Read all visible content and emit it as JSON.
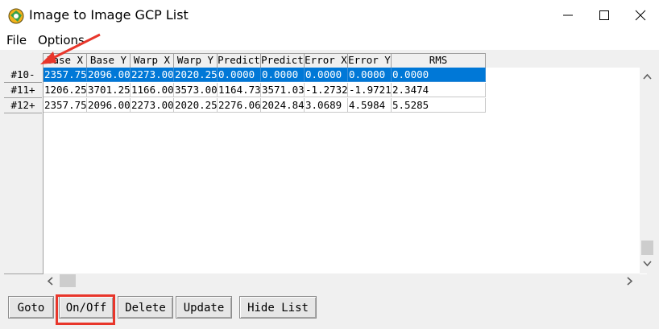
{
  "window": {
    "title": "Image to Image GCP List",
    "minimize_icon": "minimize-icon",
    "maximize_icon": "maximize-icon",
    "close_icon": "close-icon"
  },
  "menu": {
    "file": "File",
    "options": "Options"
  },
  "grid": {
    "columns": [
      "Base X",
      "Base Y",
      "Warp X",
      "Warp Y",
      "Predict",
      "Predict",
      "Error X",
      "Error Y",
      "RMS"
    ],
    "rows": [
      {
        "header": "#10-",
        "selected": true,
        "cells": [
          "2357.75",
          "2096.00",
          "2273.00",
          "2020.25",
          "0.0000",
          "0.0000",
          "0.0000",
          "0.0000",
          "0.0000"
        ]
      },
      {
        "header": "#11+",
        "selected": false,
        "cells": [
          "1206.25",
          "3701.25",
          "1166.00",
          "3573.00",
          "1164.73",
          "3571.03",
          "-1.2732",
          "-1.9721",
          "2.3474"
        ]
      },
      {
        "header": "#12+",
        "selected": false,
        "cells": [
          "2357.75",
          "2096.00",
          "2273.00",
          "2020.25",
          "2276.06",
          "2024.84",
          "3.0689",
          "4.5984",
          "5.5285"
        ]
      }
    ]
  },
  "buttons": {
    "goto": "Goto",
    "on_off": "On/Off",
    "delete": "Delete",
    "update": "Update",
    "hide_list": "Hide List"
  },
  "annotations": {
    "highlight_color": "#e8362b",
    "selection_color": "#0078d7"
  }
}
